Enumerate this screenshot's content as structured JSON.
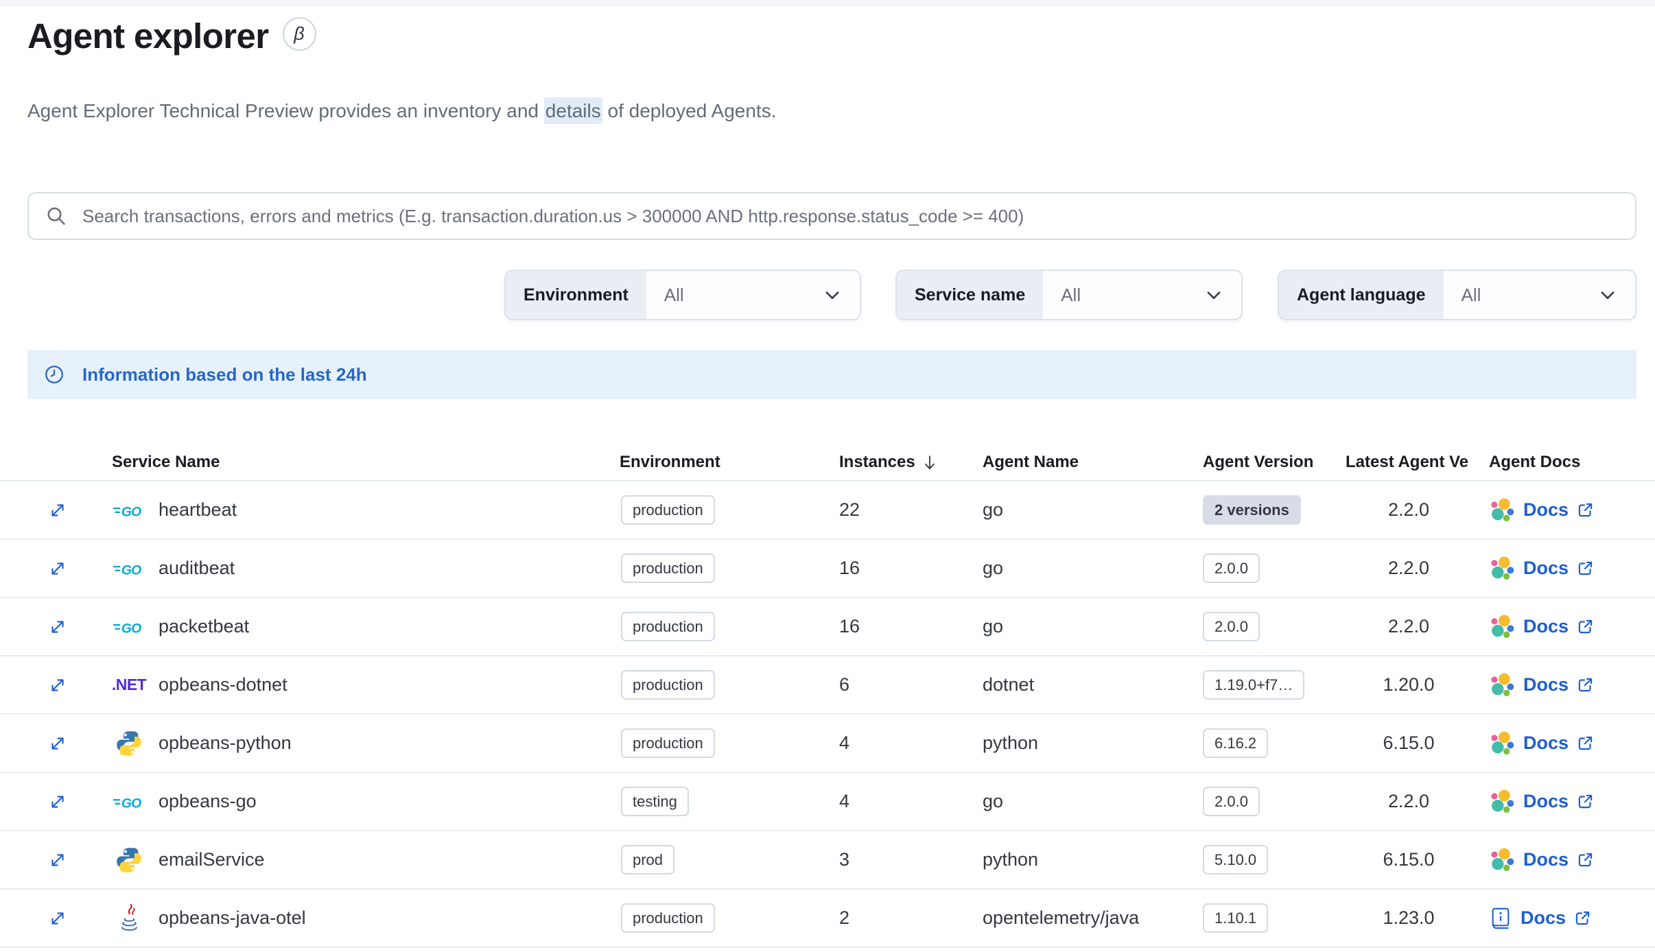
{
  "page": {
    "title": "Agent explorer",
    "beta_badge": "β",
    "subtitle": {
      "before": "Agent Explorer Technical Preview provides an inventory and ",
      "highlighted": "details",
      "after": " of deployed Agents."
    }
  },
  "search": {
    "placeholder": "Search transactions, errors and metrics (E.g. transaction.duration.us > 300000 AND http.response.status_code >= 400)"
  },
  "filters": [
    {
      "label": "Environment",
      "value": "All"
    },
    {
      "label": "Service name",
      "value": "All"
    },
    {
      "label": "Agent language",
      "value": "All"
    }
  ],
  "banner": {
    "text": "Information based on the last 24h"
  },
  "table": {
    "headers": {
      "service": "Service Name",
      "environment": "Environment",
      "instances": "Instances",
      "agent_name": "Agent Name",
      "agent_version": "Agent Version",
      "latest_version": "Latest Agent Ve",
      "docs": "Agent Docs"
    },
    "sort": {
      "column": "Instances",
      "direction": "descending"
    },
    "rows": [
      {
        "service": "heartbeat",
        "language": "go",
        "environment": "production",
        "instances": "22",
        "agent_name": "go",
        "agent_version": "2 versions",
        "version_style": "filled",
        "latest_version": "2.2.0",
        "docs": {
          "icon": "elastic-logo-icon",
          "label": "Docs"
        }
      },
      {
        "service": "auditbeat",
        "language": "go",
        "environment": "production",
        "instances": "16",
        "agent_name": "go",
        "agent_version": "2.0.0",
        "version_style": "hollow",
        "latest_version": "2.2.0",
        "docs": {
          "icon": "elastic-logo-icon",
          "label": "Docs"
        }
      },
      {
        "service": "packetbeat",
        "language": "go",
        "environment": "production",
        "instances": "16",
        "agent_name": "go",
        "agent_version": "2.0.0",
        "version_style": "hollow",
        "latest_version": "2.2.0",
        "docs": {
          "icon": "elastic-logo-icon",
          "label": "Docs"
        }
      },
      {
        "service": "opbeans-dotnet",
        "language": "dotnet",
        "environment": "production",
        "instances": "6",
        "agent_name": "dotnet",
        "agent_version": "1.19.0+f7…",
        "version_style": "hollow",
        "latest_version": "1.20.0",
        "docs": {
          "icon": "elastic-logo-icon",
          "label": "Docs"
        }
      },
      {
        "service": "opbeans-python",
        "language": "python",
        "environment": "production",
        "instances": "4",
        "agent_name": "python",
        "agent_version": "6.16.2",
        "version_style": "hollow",
        "latest_version": "6.15.0",
        "docs": {
          "icon": "elastic-logo-icon",
          "label": "Docs"
        }
      },
      {
        "service": "opbeans-go",
        "language": "go",
        "environment": "testing",
        "instances": "4",
        "agent_name": "go",
        "agent_version": "2.0.0",
        "version_style": "hollow",
        "latest_version": "2.2.0",
        "docs": {
          "icon": "elastic-logo-icon",
          "label": "Docs"
        }
      },
      {
        "service": "emailService",
        "language": "python",
        "environment": "prod",
        "instances": "3",
        "agent_name": "python",
        "agent_version": "5.10.0",
        "version_style": "hollow",
        "latest_version": "6.15.0",
        "docs": {
          "icon": "elastic-logo-icon",
          "label": "Docs"
        }
      },
      {
        "service": "opbeans-java-otel",
        "language": "java",
        "environment": "production",
        "instances": "2",
        "agent_name": "opentelemetry/java",
        "agent_version": "1.10.1",
        "version_style": "hollow",
        "latest_version": "1.23.0",
        "docs": {
          "icon": "book-icon",
          "label": "Docs"
        }
      }
    ]
  },
  "colors": {
    "link_blue": "#1d5fd0",
    "banner_text": "#2667c4",
    "banner_bg": "#e7f1fb",
    "badge_border": "#d3dae6",
    "text": "#343741",
    "subdued_text": "#69707d",
    "go_brand": "#00ACD7",
    "dotnet_brand": "#512BD4"
  }
}
